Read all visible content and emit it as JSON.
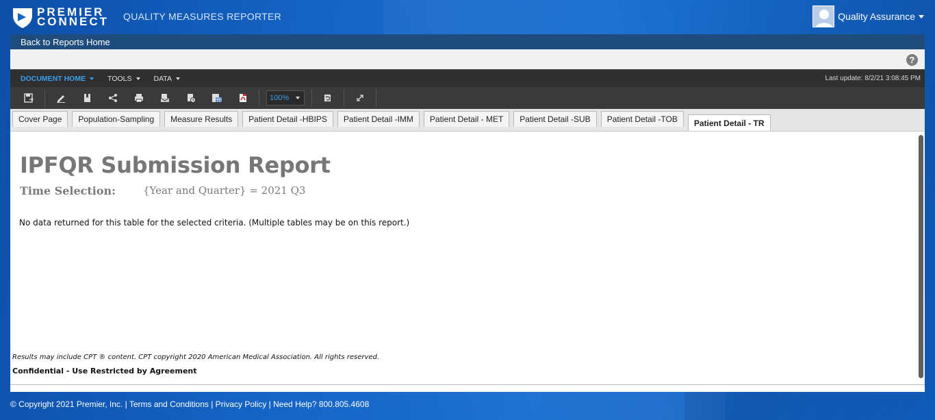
{
  "header": {
    "logo_line1": "PREMIER",
    "logo_line2": "CONNECT",
    "app_title": "QUALITY MEASURES REPORTER",
    "user_name": "Quality Assurance"
  },
  "nav": {
    "back_label": "Back to Reports Home"
  },
  "menu": {
    "items": [
      {
        "label": "DOCUMENT HOME"
      },
      {
        "label": "TOOLS"
      },
      {
        "label": "DATA"
      }
    ],
    "last_update": "Last update: 8/2/21 3:08:45 PM"
  },
  "toolbar": {
    "zoom": "100%",
    "icons": [
      "save-icon",
      "edit-icon",
      "bookmark-icon",
      "share-icon",
      "print-icon",
      "send-icon",
      "schedule-icon",
      "export-excel-icon",
      "export-pdf-icon",
      "zoom-select",
      "refresh-icon",
      "fullscreen-icon"
    ]
  },
  "tabs": [
    {
      "label": "Cover Page",
      "active": false
    },
    {
      "label": "Population-Sampling",
      "active": false
    },
    {
      "label": "Measure Results",
      "active": false
    },
    {
      "label": "Patient Detail -HBIPS",
      "active": false
    },
    {
      "label": "Patient Detail -IMM",
      "active": false
    },
    {
      "label": "Patient Detail - MET",
      "active": false
    },
    {
      "label": "Patient Detail -SUB",
      "active": false
    },
    {
      "label": "Patient Detail -TOB",
      "active": false
    },
    {
      "label": "Patient Detail - TR",
      "active": true
    }
  ],
  "report": {
    "title": "IPFQR Submission Report",
    "time_label": "Time Selection:",
    "time_value": "{Year and Quarter} = 2021 Q3",
    "no_data": "No data returned for this table for the selected criteria. (Multiple tables may be on this report.)",
    "cpt_notice": "Results may include CPT ® content. CPT copyright  2020  American Medical Association.  All rights reserved.",
    "confidential": "Confidential - Use Restricted by Agreement"
  },
  "footer": {
    "text": "© Copyright 2021 Premier, Inc. | Terms and Conditions | Privacy Policy | Need Help? 800.805.4608"
  },
  "colors": {
    "brand_blue": "#1565c7",
    "dark_toolbar": "#3a3a3a",
    "active_menu": "#3aa0f0",
    "title_gray": "#777777"
  }
}
